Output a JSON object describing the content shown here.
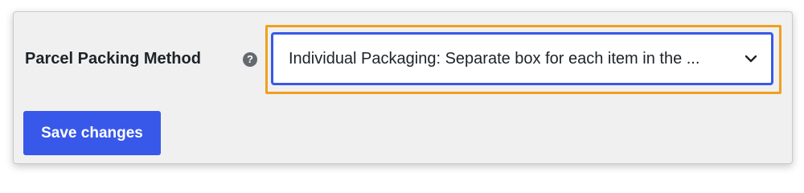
{
  "settings": {
    "parcel_packing": {
      "label": "Parcel Packing Method",
      "help_icon": "question-mark-circle-icon",
      "help_glyph": "?",
      "selected_value": "Individual Packaging: Separate box for each item in the ...",
      "dropdown_icon": "chevron-down-icon"
    },
    "save_label": "Save changes"
  },
  "colors": {
    "accent": "#3858e9",
    "highlight": "#f0a01e",
    "panel_background": "#f0f0f1",
    "text": "#1d2327",
    "help_icon": "#646970"
  }
}
